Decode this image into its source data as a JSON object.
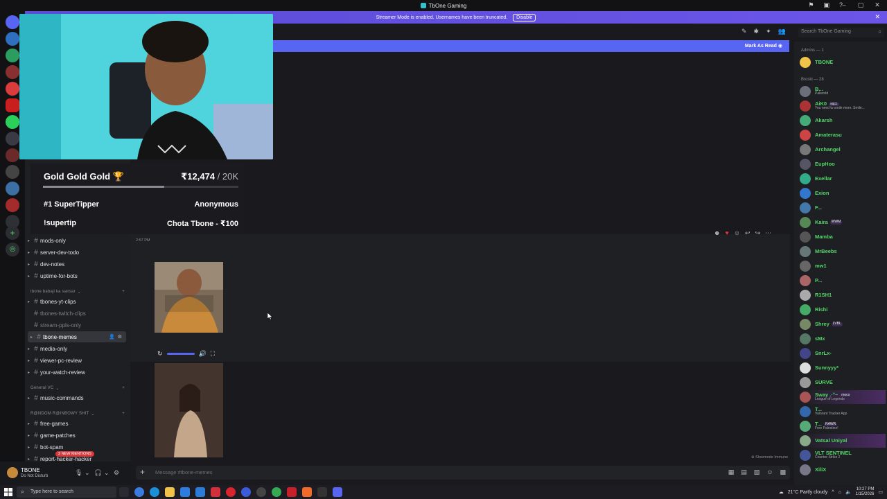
{
  "window": {
    "title": "TbOne Gaming"
  },
  "streamer_banner": {
    "text": "Streamer Mode is enabled. Usernames have been truncated.",
    "button": "Disable"
  },
  "unread_bar": {
    "label": "Mark As Read"
  },
  "search": {
    "placeholder": "Search TbOne Gaming"
  },
  "overlay": {
    "goal_title": "Gold Gold Gold 🏆",
    "goal_amount": "₹12,474",
    "goal_target": " / 20K",
    "goal_progress": 0.62,
    "supertipper_label": "#1 SuperTipper",
    "supertipper_name": "Anonymous",
    "command": "!supertip",
    "last_tip": "Chota Tbone - ₹100"
  },
  "sidebar": {
    "channels": [
      {
        "name": "mods-only"
      },
      {
        "name": "server-dev-todo"
      },
      {
        "name": "dev-notes"
      },
      {
        "name": "uptime-for-bots"
      }
    ],
    "category1": "tbone babaji ka sansar",
    "channels2": [
      {
        "name": "tbones-yt-clips",
        "muted": false
      },
      {
        "name": "tbones-twitch-clips",
        "muted": true
      },
      {
        "name": "stream-ppls-only",
        "muted": true
      },
      {
        "name": "tbone-memes",
        "muted": false,
        "active": true
      },
      {
        "name": "media-only",
        "muted": false
      },
      {
        "name": "viewer-pc-review",
        "muted": false
      },
      {
        "name": "your-watch-review",
        "muted": false
      }
    ],
    "category2": "General VC",
    "channels3": [
      {
        "name": "music-commands"
      }
    ],
    "category3": "R@NDOM R@INBOWY SHIT",
    "channels4": [
      {
        "name": "free-games"
      },
      {
        "name": "game-patches"
      },
      {
        "name": "bot-spam"
      },
      {
        "name": "report-hacker-hacker"
      }
    ],
    "mention_pill": "2 NEW MENTIONS"
  },
  "user_panel": {
    "name": "TBONE",
    "status": "Do Not Disturb"
  },
  "messages": {
    "timestamp": "2:57 PM",
    "slowmode": "Slowmode Immune"
  },
  "composer": {
    "placeholder": "Message #tbone-memes"
  },
  "members": {
    "group_admins": "Admins — 1",
    "admins": [
      {
        "name": "TBONE",
        "color": "#53d86a"
      }
    ],
    "group_broski": "Broski — 28",
    "broski": [
      {
        "name": "B...",
        "sub": "Palworld",
        "color": "#53d86a"
      },
      {
        "name": "AiK0",
        "tag": "sqcL",
        "sub": "You need to smile more. Smile...",
        "color": "#53d86a"
      },
      {
        "name": "Akarsh",
        "color": "#53d86a"
      },
      {
        "name": "Amaterasu",
        "color": "#53d86a"
      },
      {
        "name": "Archangel",
        "color": "#53d86a"
      },
      {
        "name": "EupHoo",
        "color": "#53d86a"
      },
      {
        "name": "Exellar",
        "color": "#53d86a"
      },
      {
        "name": "Exion",
        "color": "#53d86a"
      },
      {
        "name": "F...",
        "color": "#53d86a"
      },
      {
        "name": "Kaira",
        "tag": "WWM",
        "color": "#53d86a"
      },
      {
        "name": "Mamba",
        "color": "#53d86a"
      },
      {
        "name": "MrBeebs",
        "color": "#53d86a"
      },
      {
        "name": "mw1",
        "color": "#53d86a"
      },
      {
        "name": "P...",
        "color": "#53d86a"
      },
      {
        "name": "R1SH1",
        "color": "#53d86a"
      },
      {
        "name": "Rishi",
        "color": "#53d86a"
      },
      {
        "name": "Shrey",
        "tag": "LVBL",
        "color": "#53d86a"
      },
      {
        "name": "sMx",
        "color": "#53d86a"
      },
      {
        "name": "SnrLx-",
        "color": "#53d86a"
      },
      {
        "name": "Sunnyyy*",
        "color": "#53d86a"
      },
      {
        "name": "SURVE",
        "color": "#53d86a"
      },
      {
        "name": "Sway .·°~",
        "tag": "moco",
        "sub": "League of Legends",
        "color": "#53d86a",
        "boost": true
      },
      {
        "name": "T...",
        "sub": "Valorant Tracker App",
        "color": "#53d86a"
      },
      {
        "name": "T...",
        "tag": "RAWR",
        "sub": "Free Palestine!",
        "color": "#53d86a"
      },
      {
        "name": "Vatsal Uniyal",
        "color": "#53d86a",
        "boost": true
      },
      {
        "name": "VLT SENTINEL",
        "sub": "Counter-Strike 2",
        "color": "#53d86a"
      },
      {
        "name": "XiliX",
        "color": "#53d86a"
      }
    ]
  },
  "taskbar": {
    "search_placeholder": "Type here to search",
    "weather": "21°C  Partly cloudy",
    "time": "10:27 PM",
    "date": "1/15/2026"
  },
  "colors": {
    "accent": "#5865f2",
    "online_green": "#53d86a",
    "mention_red": "#da373c"
  }
}
